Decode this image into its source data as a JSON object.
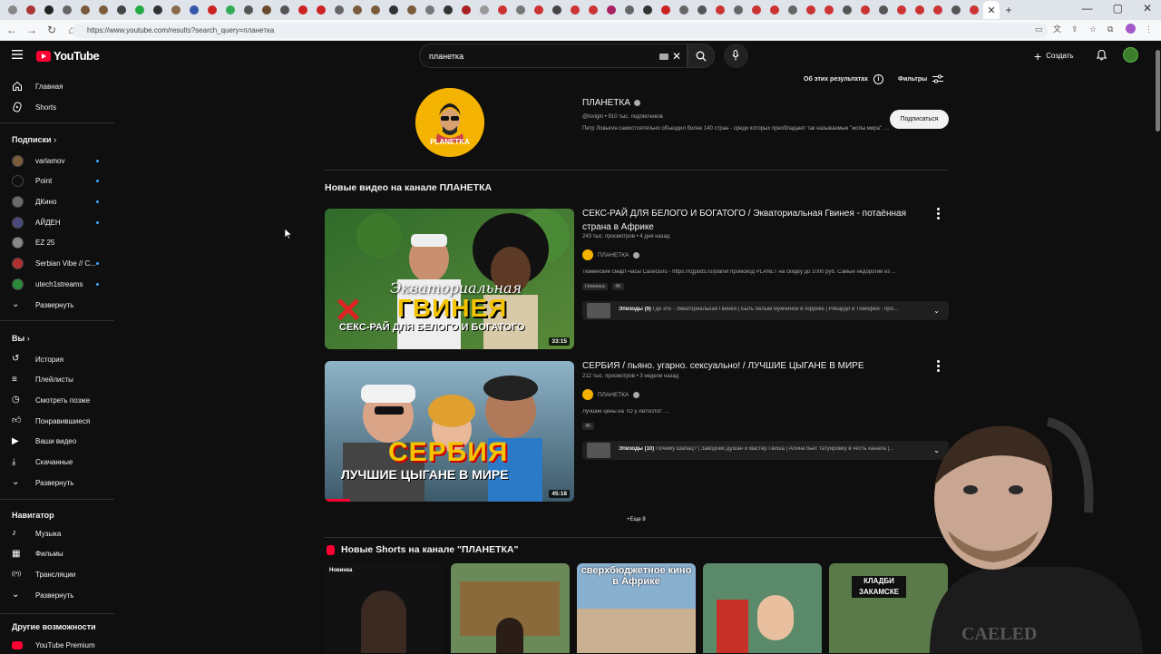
{
  "browser": {
    "url": "https://www.youtube.com/results?search_query=планетка",
    "tab_icon_colors": [
      "#888",
      "#aa3333",
      "#222",
      "#666",
      "#7a5c3a",
      "#7a5c3a",
      "#444",
      "#22aa44",
      "#333",
      "#8a6a4a",
      "#3355aa",
      "#cc2222",
      "#33aa55",
      "#555",
      "#6b4a2a",
      "#555",
      "#cc2222",
      "#cc2222",
      "#666",
      "#7a5c3a",
      "#7a5c3a",
      "#333",
      "#7a5c3a",
      "#777",
      "#333",
      "#aa2222",
      "#999",
      "#cc3333",
      "#777",
      "#cc3333",
      "#444",
      "#cc3333",
      "#cc3333",
      "#aa2266",
      "#666",
      "#333",
      "#cc2222",
      "#666",
      "#555",
      "#cc3333",
      "#666",
      "#cc3333",
      "#cc3333",
      "#666",
      "#cc3333",
      "#cc3333",
      "#555",
      "#cc3333",
      "#555",
      "#cc3333",
      "#cc3333",
      "#cc3333",
      "#555",
      "#cc3333"
    ]
  },
  "masthead": {
    "logo_text": "YouTube",
    "search_value": "планетка",
    "create_label": "Создать"
  },
  "sidebar": {
    "home": "Главная",
    "shorts": "Shorts",
    "subs_header": "Подписки",
    "subscriptions": [
      {
        "label": "varlamov",
        "color": "#7a5c3a",
        "dot": true
      },
      {
        "label": "Point",
        "color": "#0f0f0f",
        "dot": true
      },
      {
        "label": "ДКино",
        "color": "#6b6b6b",
        "dot": true
      },
      {
        "label": "АЙДЕН",
        "color": "#4a4a7a",
        "dot": true
      },
      {
        "label": "EZ 25",
        "color": "#888888",
        "dot": false
      },
      {
        "label": "Serbian Vibe // C...",
        "color": "#b03030",
        "dot": true
      },
      {
        "label": "utech1streams",
        "color": "#2d8a3a",
        "dot": true
      }
    ],
    "expand1": "Развернуть",
    "you_header": "Вы",
    "you_items": [
      "История",
      "Плейлисты",
      "Смотреть позже",
      "Понравившиеся",
      "Ваши видео",
      "Скачанные",
      "Развернуть"
    ],
    "nav_header": "Навигатор",
    "nav_items": [
      "Музыка",
      "Фильмы",
      "Трансляции",
      "Развернуть"
    ],
    "other_header": "Другие возможности",
    "premium": "YouTube Premium"
  },
  "topbar": {
    "about_results": "Об этих результатах",
    "filters": "Фильтры"
  },
  "channel": {
    "name": "ПЛАНЕТКА",
    "logo_text": "PLANETKA",
    "meta": "@lovigin • 910 тыс. подписчиков",
    "desc": "Петр Ловыгин самостоятельно объездил более 140 стран - среди которых преобладают так называемые \"жопы мира\". ...",
    "subscribe": "Подписаться"
  },
  "section_title": "Новые видео на канале ПЛАНЕТКА",
  "videos": [
    {
      "title": "СЕКС-РАЙ ДЛЯ БЕЛОГО И БОГАТОГО / Экваториальная Гвинея - потаённая страна в Африке",
      "meta": "243 тыс. просмотров • 4 дня назад",
      "channel": "ПЛАНЕТКА",
      "desc": "Тюменские смарт-часы CaseGuru - https://cgpods.ru/planet промокод PLANET на скидку до 1000 руб. Самые недорогие из ...",
      "badges": [
        "Новинка",
        "4K"
      ],
      "duration": "33:15",
      "thumb_big": "ГВИНЕЯ",
      "thumb_sub": "СЕКС-РАЙ ДЛЯ БЕЛОГО И БОГАТОГО",
      "thumb_script": "Экваториальная",
      "episodes_label": "Эпизоды (9)",
      "episodes_text": "Где это - Экваториальная Гвинея | Быть белым мужчиной в Африке | Рикардо и Тимофей - про..."
    },
    {
      "title": "СЕРБИЯ / пьяно. угарно. сексуально! / ЛУЧШИЕ ЦЫГАНЕ В МИРЕ",
      "meta": "212 тыс. просмотров • 3 недели назад",
      "channel": "ПЛАНЕТКА",
      "desc": "Лучшие цены на ТО у Автоспот: ...",
      "badges": [
        "4K"
      ],
      "duration": "45:18",
      "progress": 0.1,
      "thumb_big": "СЕРБИЯ",
      "thumb_sub": "ЛУЧШИЕ ЦЫГАНЕ В МИРЕ",
      "episodes_label": "Эпизоды (10)",
      "episodes_text": "Почему Шабац? | Заводчик Душан и мастер Гвиша | Алина бьет татуировку в честь канала |..."
    }
  ],
  "more_link": "+Еще 8",
  "shorts_title": "Новые Shorts на канале \"ПЛАНЕТКА\"",
  "shorts": [
    {
      "label": "Новинка",
      "caption": ""
    },
    {
      "label": "",
      "caption": ""
    },
    {
      "label": "",
      "caption": "сверхбюджетное кино в Африке"
    },
    {
      "label": "",
      "caption": ""
    },
    {
      "label": "",
      "caption": "КЛАДБИ ЗАКАМСКЕ"
    }
  ]
}
